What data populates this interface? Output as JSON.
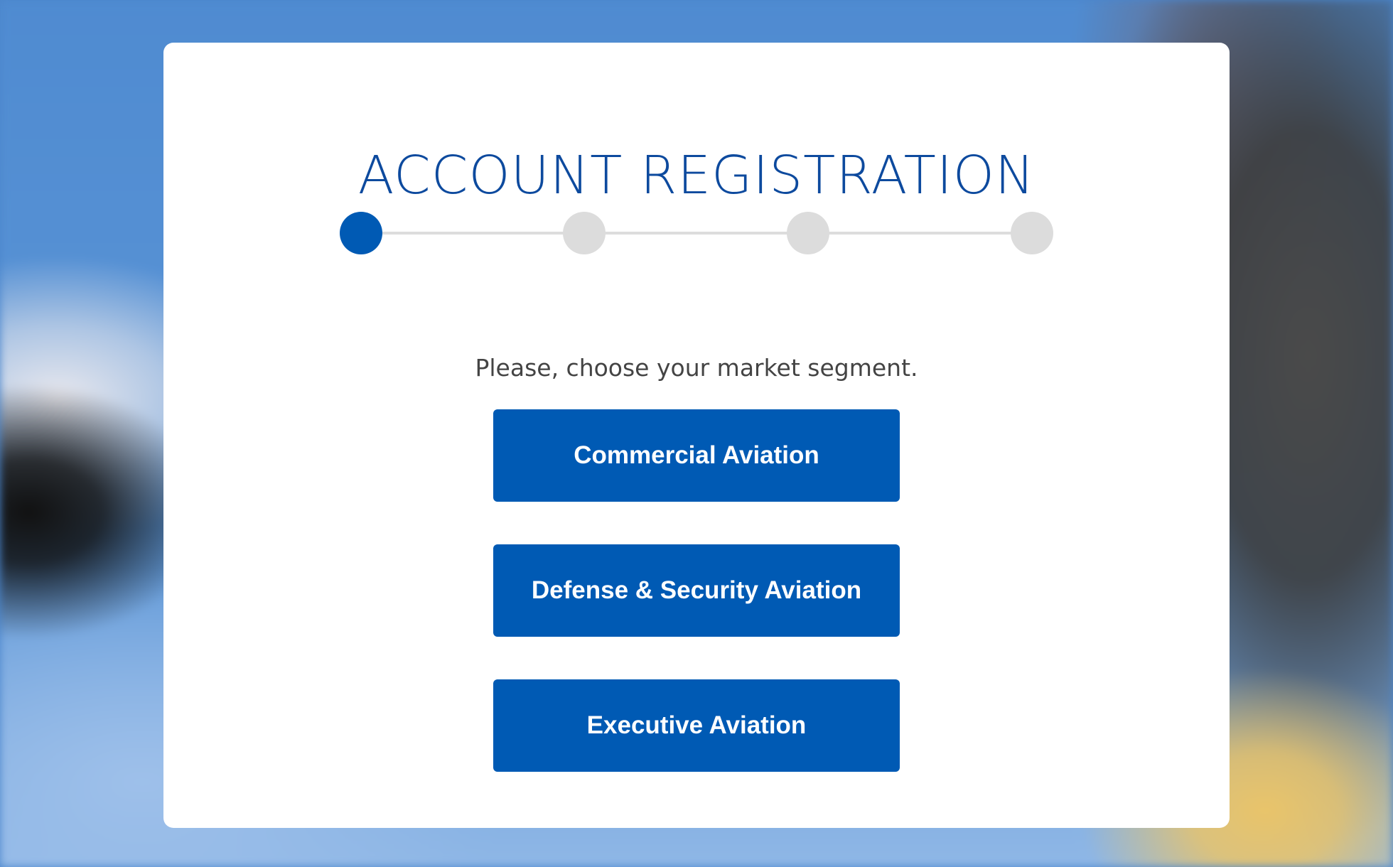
{
  "page": {
    "title": "ACCOUNT REGISTRATION",
    "prompt": "Please, choose your market segment."
  },
  "stepper": {
    "total_steps": 4,
    "current_step": 1,
    "active_color": "#005ab4",
    "inactive_color": "#dcdcdc"
  },
  "segments": [
    {
      "label": "Commercial Aviation"
    },
    {
      "label": "Defense & Security Aviation"
    },
    {
      "label": "Executive Aviation"
    }
  ],
  "colors": {
    "title": "#0d4a9e",
    "button": "#005ab4",
    "button_text": "#ffffff",
    "card": "#ffffff"
  }
}
